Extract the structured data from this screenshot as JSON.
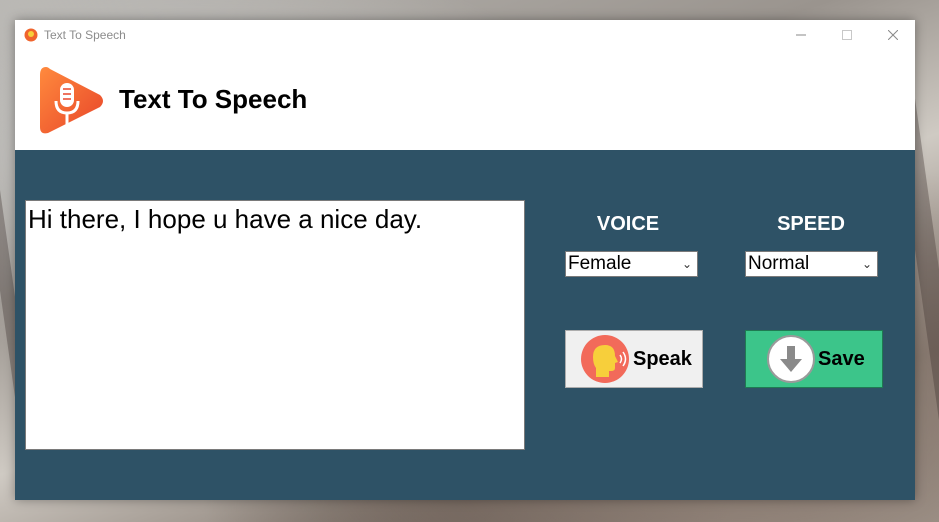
{
  "window": {
    "title": "Text To Speech"
  },
  "header": {
    "heading": "Text To Speech"
  },
  "editor": {
    "text": "Hi there, I hope u have a nice day."
  },
  "voice": {
    "label": "VOICE",
    "selected": "Female"
  },
  "speed": {
    "label": "SPEED",
    "selected": "Normal"
  },
  "buttons": {
    "speak_label": "Speak",
    "save_label": "Save"
  },
  "colors": {
    "panel_bg": "#2e5266",
    "save_green": "#3cc58a",
    "logo_orange": "#f0642d",
    "speak_icon_red": "#f26a5a",
    "speak_icon_yellow": "#f7cf3b"
  },
  "icons": {
    "logo": "microphone-play-icon",
    "speak": "speaking-head-icon",
    "save": "download-arrow-icon"
  }
}
